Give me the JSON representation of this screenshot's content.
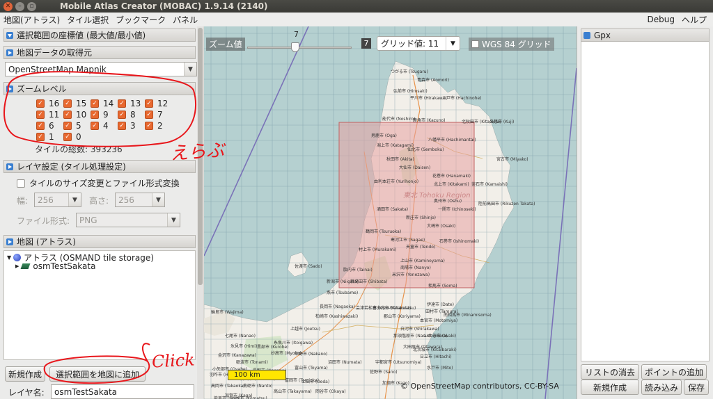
{
  "window": {
    "title": "Mobile Atlas Creator (MOBAC) 1.9.14 (2140)"
  },
  "menu": {
    "items": [
      "地図(アトラス)",
      "タイル選択",
      "ブックマーク",
      "パネル"
    ],
    "debug": "Debug",
    "help": "ヘルプ"
  },
  "left": {
    "coords_header": "選択範囲の座標値 (最大値/最小値)",
    "source_header": "地図データの取得元",
    "source_value": "OpenStreetMap Mapnik",
    "zoom_header": "ズームレベル",
    "zoom_levels": [
      "16",
      "15",
      "14",
      "13",
      "12",
      "11",
      "10",
      "9",
      "8",
      "7",
      "6",
      "5",
      "4",
      "3",
      "2",
      "1",
      "0"
    ],
    "tile_total": "タイルの総数: 393236",
    "layer_header": "レイヤ設定 (タイル処理設定)",
    "resize_label": "タイルのサイズ変更とファイル形式変換",
    "width_label": "幅:",
    "width_value": "256",
    "height_label": "高さ:",
    "height_value": "256",
    "format_label": "ファイル形式:",
    "format_value": "PNG",
    "atlas_header": "地図 (アトラス)",
    "atlas_root": "アトラス (OSMAND tile storage)",
    "atlas_child": "osmTestSakata",
    "new_button": "新規作成",
    "add_button": "選択範囲を地図に追加",
    "layer_name_label": "レイヤ名:",
    "layer_name_value": "osmTestSakata"
  },
  "annotations": {
    "handwritten_1": "えらぶ",
    "handwritten_2": "Click"
  },
  "map": {
    "zoom_label": "ズーム値",
    "zoom_slider_value": "7",
    "zoom_value_box": "7",
    "grid_value": "グリッド値: 11",
    "wgs_label": "WGS 84 グリッド",
    "scale": "100 km",
    "attribution": "© OpenStreetMap contributors, CC-BY-SA",
    "place_labels": [
      "つがる市 (Tsugaru)",
      "青森市 (Aomori)",
      "弘前市 (Hirosaki)",
      "平川市 (Hirakawa)",
      "八戸市 (Hachinohe)",
      "能代市 (Noshiro)",
      "鹿角市 (Kazuno)",
      "北秋田市 (Kitaakita)",
      "久慈市 (Kuji)",
      "男鹿市 (Oga)",
      "八幡平市 (Hachimantai)",
      "潟上市 (Katagami)",
      "仙北市 (Semboku)",
      "秋田市 (Akita)",
      "宮古市 (Miyako)",
      "大仙市 (Daisen)",
      "花巻市 (Hanamaki)",
      "由利本荘市 (Yurihonjo)",
      "北上市 (Kitakami)",
      "釜石市 (Kamaishi)",
      "東北 Tohoku Region",
      "奥州市 (Oshu)",
      "酒田市 (Sakata)",
      "一関市 (Ichinoseki)",
      "陸前高田市 (Rikuzen Takata)",
      "新庄市 (Shinjo)",
      "大崎市 (Osaki)",
      "鶴岡市 (Tsuruoka)",
      "石巻市 (Ishinomaki)",
      "寒河江市 (Sagae)",
      "天童市 (Tendo)",
      "村上市 (Murakami)",
      "上山市 (Kaminoyama)",
      "南陽市 (Nanyo)",
      "佐渡市 (Sado)",
      "胎内市 (Tainai)",
      "米沢市 (Yonezawa)",
      "新発田市 (Shibata)",
      "相馬市 (Soma)",
      "新潟市 (Niigata)",
      "伊達市 (Date)",
      "喜多方市 (Kitakata)",
      "燕市 (Tsubame)",
      "南相馬市 (Minamisoma)",
      "本宮市 (Motomiya)",
      "長岡市 (Nagaoka)",
      "会津若松市 (Aizu-Wakamatsu)",
      "田村市 (Tamura)",
      "柏崎市 (Kashiwazaki)",
      "郡山市 (Koriyama)",
      "輪島市 (Wajima)",
      "上越市 (Joetsu)",
      "白河市 (Shirakawa)",
      "いわき市 (Iwaki)",
      "那須塩原市 (Nasushiobara)",
      "七尾市 (Nanao)",
      "糸魚川市 (Itoigawa)",
      "大田原市 (Otawara)",
      "北茨城市 (Kitaibaraki)",
      "氷見市 (Himi)",
      "黒部市 (Kurobe)",
      "妙高市 (Myoko)",
      "日立市 (Hitachi)",
      "砺波市 (Tonami)",
      "中野市 (Nakano)",
      "沼田市 (Numata)",
      "宇都宮市 (Utsunomiya)",
      "長野市 (Nagano)",
      "水戸市 (Mito)",
      "白山市 (Hakusan)",
      "高山市 (Takayama)",
      "富岡市 (Tomioka)",
      "佐野市 (Sano)",
      "加須市 (Kazo)",
      "岡谷市 (Okaya)",
      "高岡市 (Takaoka)",
      "南砺市 (Nanto)",
      "上田市 (Ueda)",
      "富山市 (Toyama)",
      "小矢部市 (Oyabe)",
      "金沢市 (Kanazawa)",
      "羽咋市 (Hakui)",
      "加賀市 (Kaga)",
      "能美市 (Nomi)",
      "小松市 (Komatsu)"
    ]
  },
  "right": {
    "gpx_header": "Gpx",
    "clear_list": "リストの消去",
    "add_point": "ポイントの追加",
    "new": "新規作成",
    "load": "読み込み",
    "save": "保存"
  },
  "colors": {
    "accent": "#e8682f",
    "selection": "#e8a3a3",
    "sea": "#b5d0d0",
    "land": "#f2efe9",
    "annotation": "#e8161b"
  }
}
